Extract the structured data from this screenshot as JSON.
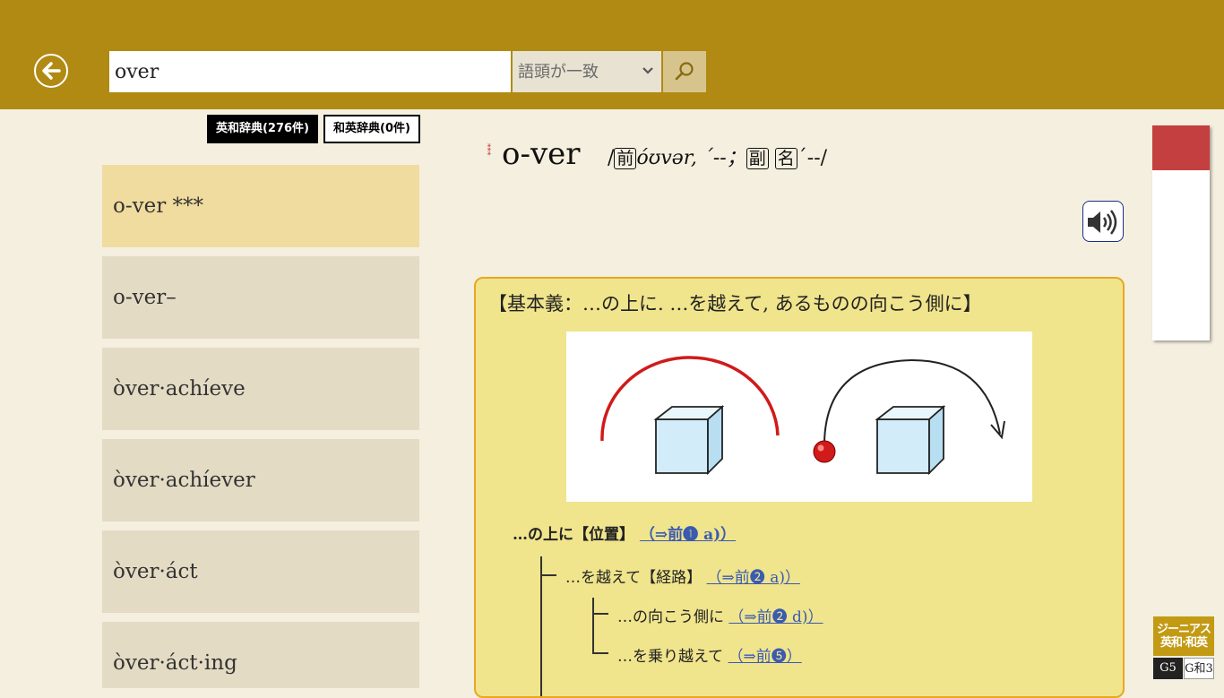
{
  "search": {
    "query": "over",
    "mode": "語頭が一致"
  },
  "dict_tabs": [
    {
      "label": "英和辞典(276件)",
      "active": true
    },
    {
      "label": "和英辞典(0件)",
      "active": false
    }
  ],
  "word_list": [
    "o-ver ***",
    "o-ver–",
    "òver·achíeve",
    "òver·achíever",
    "òver·áct",
    "òver·áct·ing"
  ],
  "entry": {
    "stars": "***",
    "headword": "o-ver",
    "pron_parts": {
      "slash_open": "/",
      "pos_prep": "前",
      "ipa": "óʊvər, ˊ--；",
      "pos_adv": "副",
      "pos_noun": "名",
      "ipa2": "ˊ--/"
    },
    "core_meaning": "【基本義：…の上に. …を越えて, あるものの向こう側に】",
    "senses": [
      {
        "text": "…の上に【位置】",
        "ref": "（⇒前❶ a)）"
      },
      {
        "text": "…を越えて【経路】",
        "ref": "（⇒前❷ a)）"
      },
      {
        "text": "…の向こう側に",
        "ref": "（⇒前❷ d)）"
      },
      {
        "text": "…を乗り越えて",
        "ref": "（⇒前❺）"
      }
    ]
  },
  "logo": {
    "line1": "ジーニアス",
    "line2": "英和·和英",
    "g5": "G5",
    "g3": "G和3"
  },
  "colors": {
    "header": "#b08a12",
    "background": "#f4efdf",
    "selected_item": "#f0dc9f",
    "list_item": "#e4dbc4",
    "core_box": "#f0e48c",
    "core_border": "#e8a822",
    "arc_red": "#d11a1a"
  }
}
